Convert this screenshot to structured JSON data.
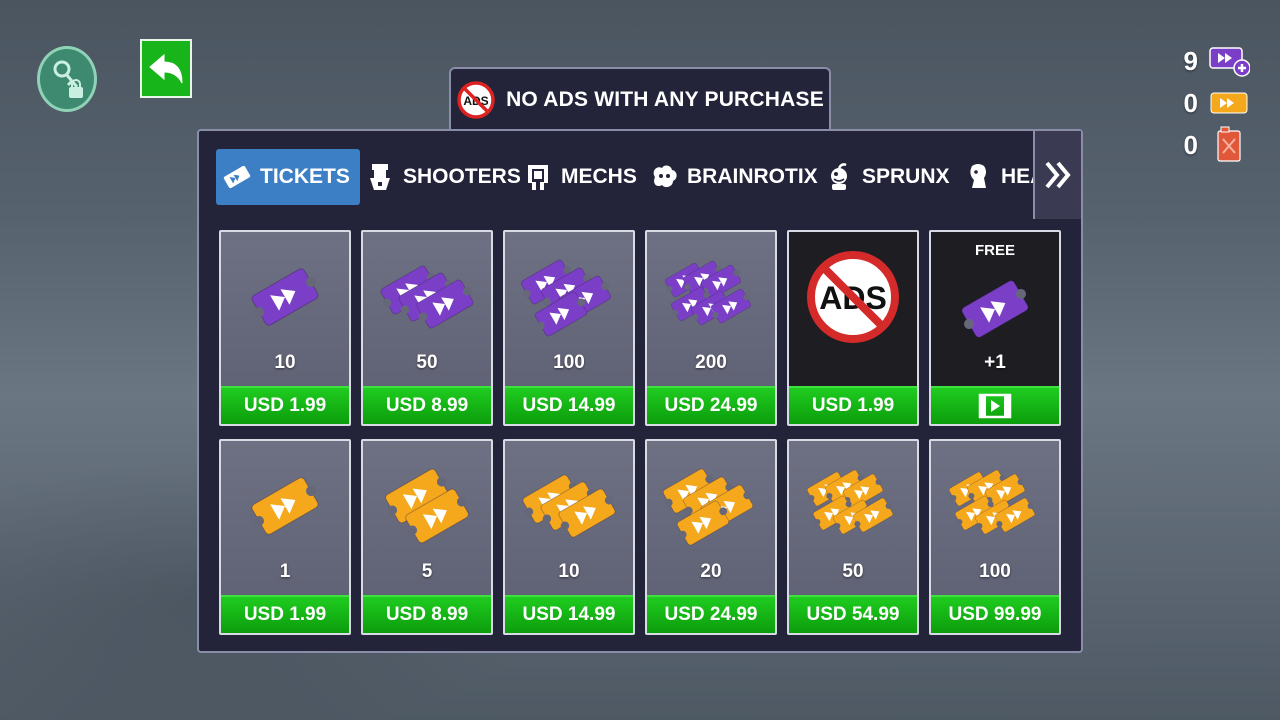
{
  "banner": {
    "icon": "no-ads-icon",
    "icon_text": "ADS",
    "text": "NO ADS WITH ANY PURCHASE"
  },
  "currency": [
    {
      "value": "9",
      "icon": "purple-ticket-plus-icon",
      "color": "#7b3fc7"
    },
    {
      "value": "0",
      "icon": "orange-ticket-icon",
      "color": "#f5a81c"
    },
    {
      "value": "0",
      "icon": "fuel-can-icon",
      "color": "#e0573a"
    }
  ],
  "tabs": [
    {
      "label": "TICKETS",
      "icon": "ticket-icon",
      "active": true
    },
    {
      "label": "SHOOTERS",
      "icon": "shooter-icon",
      "active": false
    },
    {
      "label": "MECHS",
      "icon": "mech-icon",
      "active": false
    },
    {
      "label": "BRAINROTIX",
      "icon": "brain-icon",
      "active": false
    },
    {
      "label": "SPRUNX",
      "icon": "sprunx-icon",
      "active": false
    },
    {
      "label": "HEA",
      "icon": "head-icon",
      "active": false
    }
  ],
  "row1": [
    {
      "qty": "10",
      "price": "USD 1.99",
      "ticket_color": "#7b3fc7",
      "ticket_count": 1
    },
    {
      "qty": "50",
      "price": "USD 8.99",
      "ticket_color": "#7b3fc7",
      "ticket_count": 3
    },
    {
      "qty": "100",
      "price": "USD 14.99",
      "ticket_color": "#7b3fc7",
      "ticket_count": 4
    },
    {
      "qty": "200",
      "price": "USD 24.99",
      "ticket_color": "#7b3fc7",
      "ticket_count": 6
    },
    {
      "qty": "",
      "price": "USD 1.99",
      "no_ads": true,
      "no_ads_text": "ADS"
    },
    {
      "title": "FREE",
      "qty": "+1",
      "price": "",
      "free": true,
      "ticket_color": "#7b3fc7",
      "ticket_count": 1
    }
  ],
  "row2": [
    {
      "qty": "1",
      "price": "USD 1.99",
      "ticket_color": "#f5a81c",
      "ticket_count": 1
    },
    {
      "qty": "5",
      "price": "USD 8.99",
      "ticket_color": "#f5a81c",
      "ticket_count": 2
    },
    {
      "qty": "10",
      "price": "USD 14.99",
      "ticket_color": "#f5a81c",
      "ticket_count": 3
    },
    {
      "qty": "20",
      "price": "USD 24.99",
      "ticket_color": "#f5a81c",
      "ticket_count": 4
    },
    {
      "qty": "50",
      "price": "USD 54.99",
      "ticket_color": "#f5a81c",
      "ticket_count": 6
    },
    {
      "qty": "100",
      "price": "USD 99.99",
      "ticket_color": "#f5a81c",
      "ticket_count": 6
    }
  ]
}
